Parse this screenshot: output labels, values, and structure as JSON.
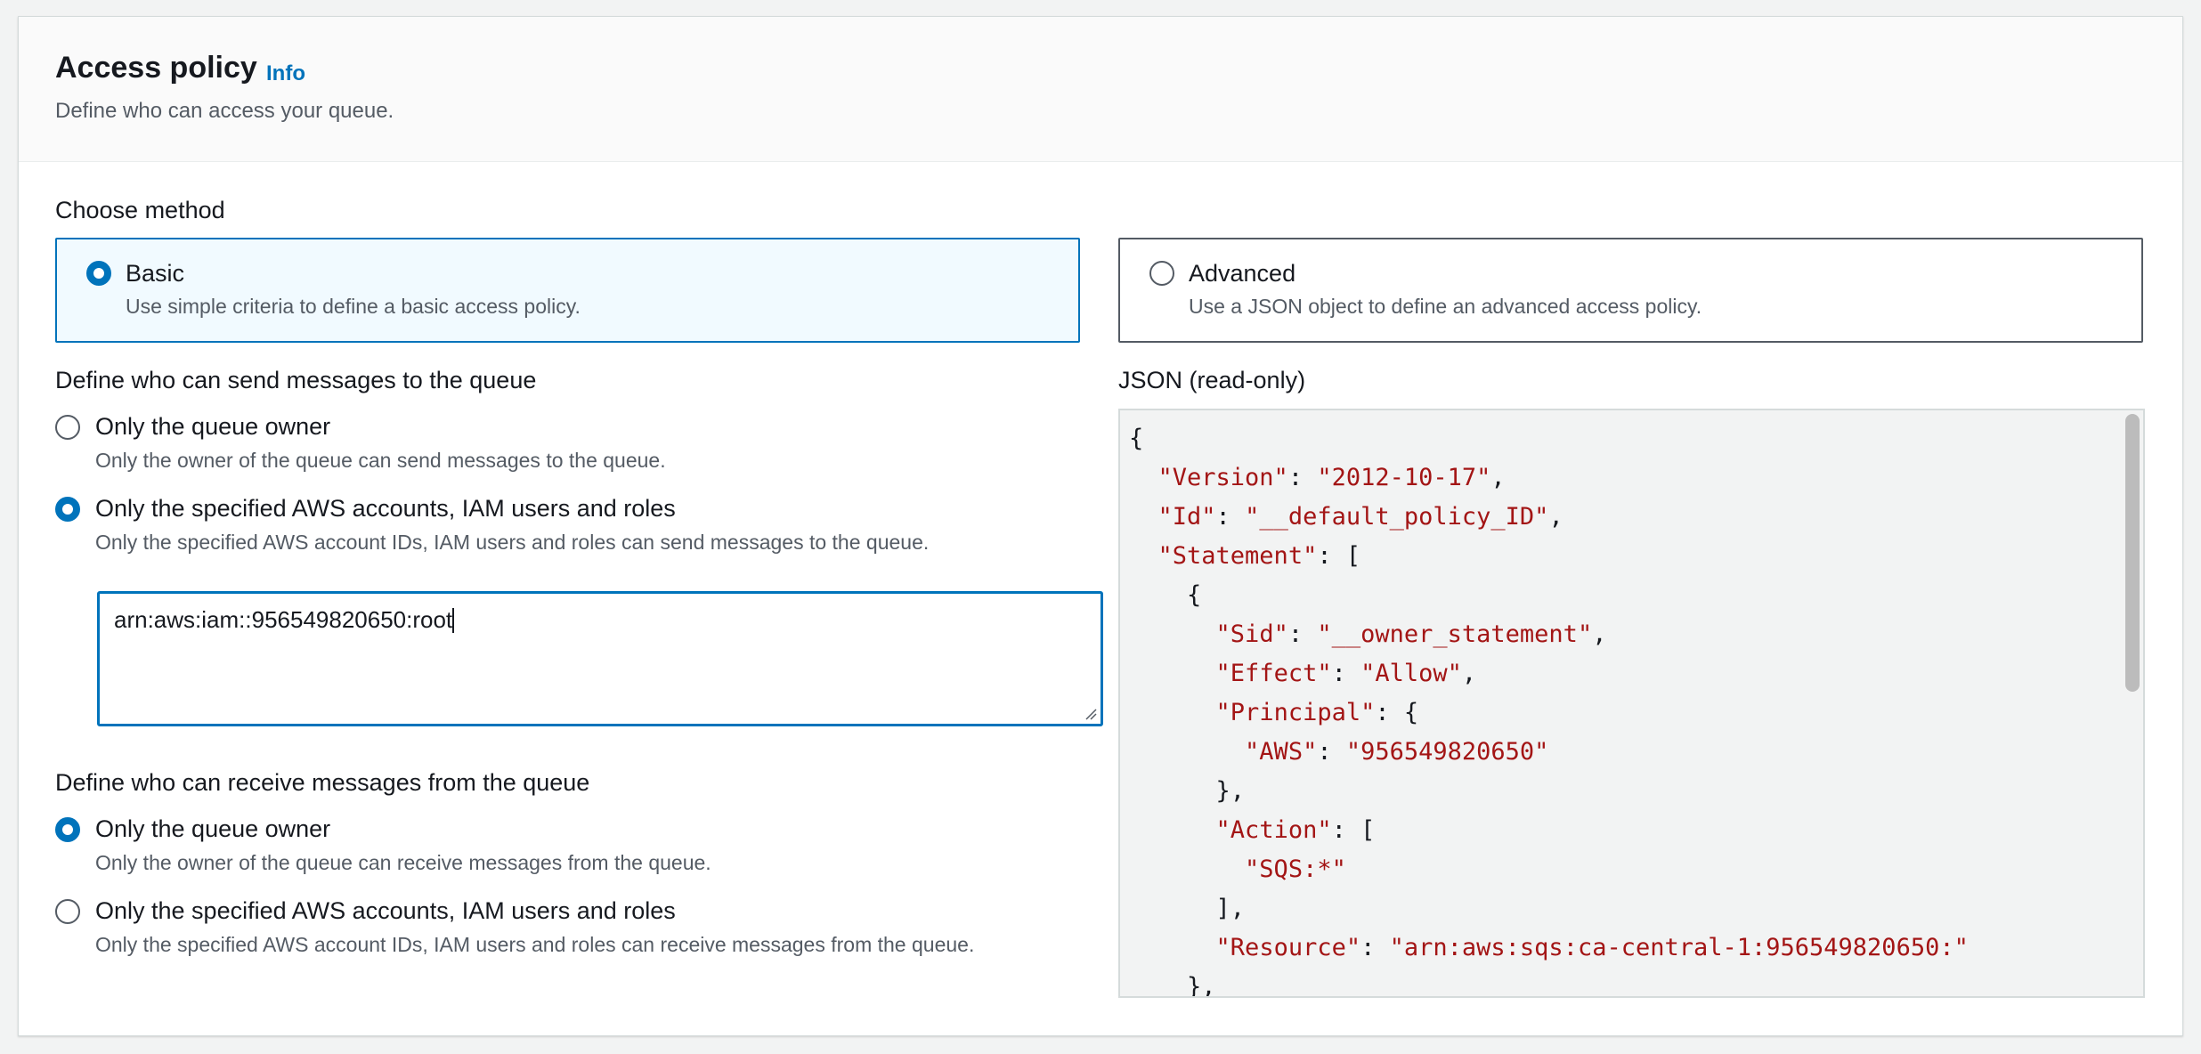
{
  "header": {
    "title": "Access policy",
    "info_link": "Info",
    "subtitle": "Define who can access your queue."
  },
  "method": {
    "label": "Choose method",
    "options": [
      {
        "label": "Basic",
        "description": "Use simple criteria to define a basic access policy.",
        "selected": true
      },
      {
        "label": "Advanced",
        "description": "Use a JSON object to define an advanced access policy.",
        "selected": false
      }
    ]
  },
  "send": {
    "label": "Define who can send messages to the queue",
    "options": [
      {
        "label": "Only the queue owner",
        "description": "Only the owner of the queue can send messages to the queue.",
        "selected": false
      },
      {
        "label": "Only the specified AWS accounts, IAM users and roles",
        "description": "Only the specified AWS account IDs, IAM users and roles can send messages to the queue.",
        "selected": true
      }
    ],
    "principals_value": "arn:aws:iam::956549820650:root"
  },
  "receive": {
    "label": "Define who can receive messages from the queue",
    "options": [
      {
        "label": "Only the queue owner",
        "description": "Only the owner of the queue can receive messages from the queue.",
        "selected": true
      },
      {
        "label": "Only the specified AWS accounts, IAM users and roles",
        "description": "Only the specified AWS account IDs, IAM users and roles can receive messages from the queue.",
        "selected": false
      }
    ]
  },
  "json_view": {
    "label": "JSON (read-only)",
    "lines": [
      [
        {
          "t": "p",
          "v": "{"
        }
      ],
      [
        {
          "t": "p",
          "v": "  "
        },
        {
          "t": "k",
          "v": "\"Version\""
        },
        {
          "t": "p",
          "v": ": "
        },
        {
          "t": "s",
          "v": "\"2012-10-17\""
        },
        {
          "t": "p",
          "v": ","
        }
      ],
      [
        {
          "t": "p",
          "v": "  "
        },
        {
          "t": "k",
          "v": "\"Id\""
        },
        {
          "t": "p",
          "v": ": "
        },
        {
          "t": "s",
          "v": "\"__default_policy_ID\""
        },
        {
          "t": "p",
          "v": ","
        }
      ],
      [
        {
          "t": "p",
          "v": "  "
        },
        {
          "t": "k",
          "v": "\"Statement\""
        },
        {
          "t": "p",
          "v": ": ["
        }
      ],
      [
        {
          "t": "p",
          "v": "    {"
        }
      ],
      [
        {
          "t": "p",
          "v": "      "
        },
        {
          "t": "k",
          "v": "\"Sid\""
        },
        {
          "t": "p",
          "v": ": "
        },
        {
          "t": "s",
          "v": "\"__owner_statement\""
        },
        {
          "t": "p",
          "v": ","
        }
      ],
      [
        {
          "t": "p",
          "v": "      "
        },
        {
          "t": "k",
          "v": "\"Effect\""
        },
        {
          "t": "p",
          "v": ": "
        },
        {
          "t": "s",
          "v": "\"Allow\""
        },
        {
          "t": "p",
          "v": ","
        }
      ],
      [
        {
          "t": "p",
          "v": "      "
        },
        {
          "t": "k",
          "v": "\"Principal\""
        },
        {
          "t": "p",
          "v": ": {"
        }
      ],
      [
        {
          "t": "p",
          "v": "        "
        },
        {
          "t": "k",
          "v": "\"AWS\""
        },
        {
          "t": "p",
          "v": ": "
        },
        {
          "t": "s",
          "v": "\"956549820650\""
        }
      ],
      [
        {
          "t": "p",
          "v": "      },"
        }
      ],
      [
        {
          "t": "p",
          "v": "      "
        },
        {
          "t": "k",
          "v": "\"Action\""
        },
        {
          "t": "p",
          "v": ": ["
        }
      ],
      [
        {
          "t": "p",
          "v": "        "
        },
        {
          "t": "s",
          "v": "\"SQS:*\""
        }
      ],
      [
        {
          "t": "p",
          "v": "      ],"
        }
      ],
      [
        {
          "t": "p",
          "v": "      "
        },
        {
          "t": "k",
          "v": "\"Resource\""
        },
        {
          "t": "p",
          "v": ": "
        },
        {
          "t": "s",
          "v": "\"arn:aws:sqs:ca-central-1:956549820650:\""
        }
      ],
      [
        {
          "t": "p",
          "v": "    },"
        }
      ]
    ]
  },
  "colors": {
    "accent": "#0073bb",
    "selected_tile_bg": "#f1faff",
    "json_string": "#a31515",
    "muted_text": "#545b64"
  }
}
